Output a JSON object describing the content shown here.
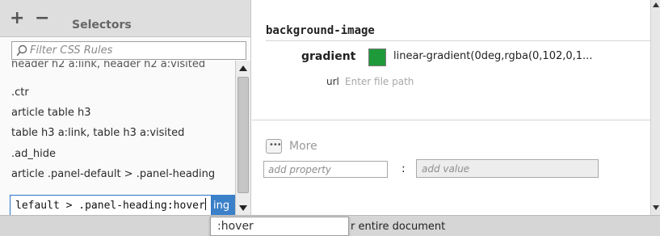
{
  "selectors": {
    "add_symbol": "+",
    "remove_symbol": "−",
    "title": "Selectors",
    "filter_placeholder": "Filter CSS Rules",
    "items": [
      "header h2 a:link, header h2 a:visited",
      ".ctr",
      "article table h3",
      "table h3 a:link, table h3 a:visited",
      ".ad_hide",
      "article .panel-default > .panel-heading"
    ],
    "editing_value": "lefault > .panel-heading:hover",
    "editing_tail": "ing"
  },
  "properties": {
    "section_title": "background-image",
    "gradient_label": "gradient",
    "gradient_color": "#1f9a3a",
    "gradient_value": "linear-gradient(0deg,rgba(0,102,0,1...",
    "url_label": "url",
    "url_placeholder": "Enter file path",
    "more_icon_text": "•••",
    "more_label": "More",
    "add_property_placeholder": "add property",
    "colon": ":",
    "add_value_placeholder": "add value"
  },
  "status": {
    "text": "r entire document"
  },
  "autocomplete": {
    "items": [
      ":hover"
    ]
  }
}
